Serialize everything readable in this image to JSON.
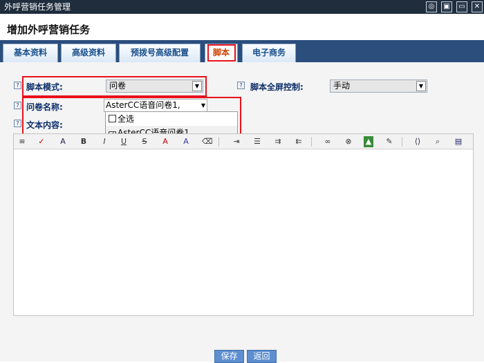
{
  "window": {
    "title": "外呼营销任务管理"
  },
  "page": {
    "title": "增加外呼营销任务"
  },
  "tabs": [
    {
      "label": "基本资料"
    },
    {
      "label": "高级资料"
    },
    {
      "label": "预拨号高级配置"
    },
    {
      "label": "脚本"
    },
    {
      "label": "电子商务"
    }
  ],
  "form": {
    "script_mode": {
      "label": "脚本模式:",
      "value": "问卷"
    },
    "fullscreen": {
      "label": "脚本全屏控制:",
      "value": "手动"
    },
    "questionnaire": {
      "label": "问卷名称:",
      "value": "AsterCC语音问卷1,",
      "options": [
        {
          "label": "全选",
          "checked": false
        },
        {
          "label": "AsterCC语音问卷1",
          "checked": true
        }
      ]
    },
    "text_content": {
      "label": "文本内容:"
    }
  },
  "toolbar_icons": [
    "format-icon",
    "spellcheck-icon",
    "font-color-icon",
    "bold-icon",
    "italic-icon",
    "underline-icon",
    "strikethrough-icon",
    "text-color-icon",
    "highlight-icon",
    "clear-format-icon",
    "ordered-list-icon",
    "unordered-list-icon",
    "indent-icon",
    "outdent-icon",
    "link-icon",
    "unlink-icon",
    "image-icon",
    "edit-icon",
    "source-icon",
    "preview-icon",
    "fullscreen-icon"
  ],
  "buttons": {
    "save": "保存",
    "back": "返回"
  },
  "colors": {
    "tabbar": "#2b4e7c",
    "highlight": "#e8101a",
    "button": "#5c8ed0"
  }
}
